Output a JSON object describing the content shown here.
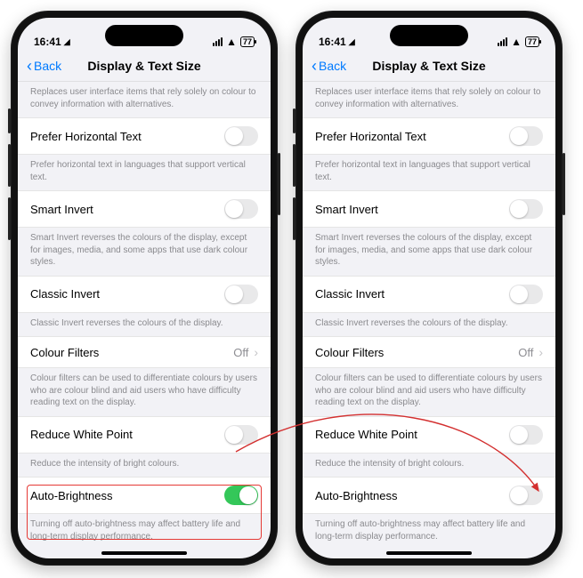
{
  "status": {
    "time": "16:41",
    "battery": "77"
  },
  "nav": {
    "back": "Back",
    "title": "Display & Text Size"
  },
  "descs": {
    "diff": "Replaces user interface items that rely solely on colour to convey information with alternatives.",
    "horiz": "Prefer horizontal text in languages that support vertical text.",
    "smart": "Smart Invert reverses the colours of the display, except for images, media, and some apps that use dark colour styles.",
    "classic": "Classic Invert reverses the colours of the display.",
    "filters": "Colour filters can be used to differentiate colours by users who are colour blind and aid users who have difficulty reading text on the display.",
    "reduce": "Reduce the intensity of bright colours.",
    "auto": "Turning off auto-brightness may affect battery life and long-term display performance."
  },
  "rows": {
    "horiz": "Prefer Horizontal Text",
    "smart": "Smart Invert",
    "classic": "Classic Invert",
    "filters": "Colour Filters",
    "filters_val": "Off",
    "reduce": "Reduce White Point",
    "auto": "Auto-Brightness"
  }
}
